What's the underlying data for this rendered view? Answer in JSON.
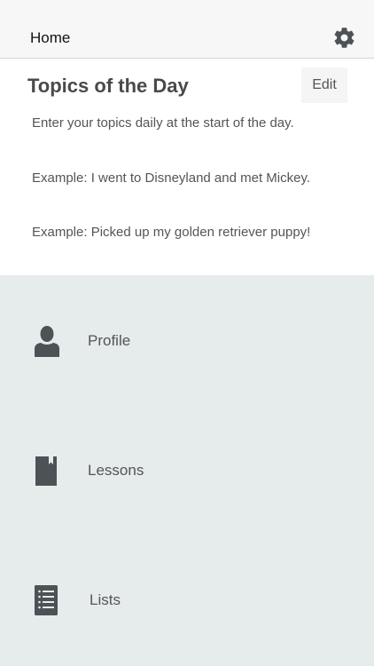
{
  "navbar": {
    "title": "Home",
    "settings_icon": "gear-icon"
  },
  "topics": {
    "title": "Topics of the Day",
    "edit_label": "Edit",
    "lines": [
      "Enter your topics daily at the start of the day.",
      "Example: I went to Disneyland and met Mickey.",
      "Example: Picked up my golden retriever puppy!"
    ]
  },
  "menu": {
    "items": [
      {
        "label": "Profile",
        "icon": "person-icon"
      },
      {
        "label": "Lessons",
        "icon": "book-icon"
      },
      {
        "label": "Lists",
        "icon": "list-icon"
      }
    ]
  },
  "colors": {
    "navbar_bg": "#f7f7f7",
    "menu_bg": "#e6ebeb",
    "icon": "#4d5256",
    "text": "#555555"
  }
}
